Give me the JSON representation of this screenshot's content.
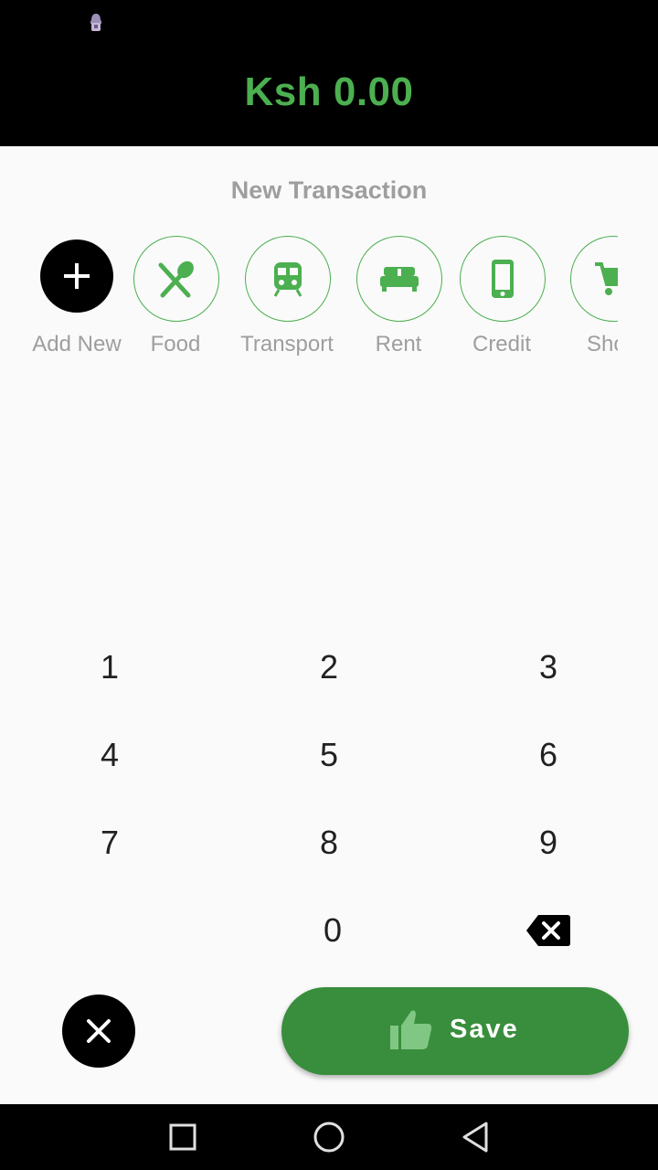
{
  "header": {
    "amount": "Ksh 0.00"
  },
  "title": "New Transaction",
  "categories": [
    {
      "label": "Add New",
      "icon": "plus-icon"
    },
    {
      "label": "Food",
      "icon": "restaurant-icon"
    },
    {
      "label": "Transport",
      "icon": "train-icon"
    },
    {
      "label": "Rent",
      "icon": "bed-icon"
    },
    {
      "label": "Credit",
      "icon": "phone-icon"
    },
    {
      "label": "Shop",
      "icon": "cart-icon"
    }
  ],
  "keypad": {
    "keys": [
      "1",
      "2",
      "3",
      "4",
      "5",
      "6",
      "7",
      "8",
      "9",
      "0"
    ],
    "backspace_icon": "backspace-icon"
  },
  "actions": {
    "cancel_icon": "close-icon",
    "save_label": "Save",
    "save_icon": "thumbs-up-icon"
  },
  "colors": {
    "accent": "#4caf50",
    "save": "#388e3c",
    "muted_text": "#9e9e9e"
  },
  "navbar": [
    "recent-apps-icon",
    "home-icon",
    "back-icon"
  ]
}
